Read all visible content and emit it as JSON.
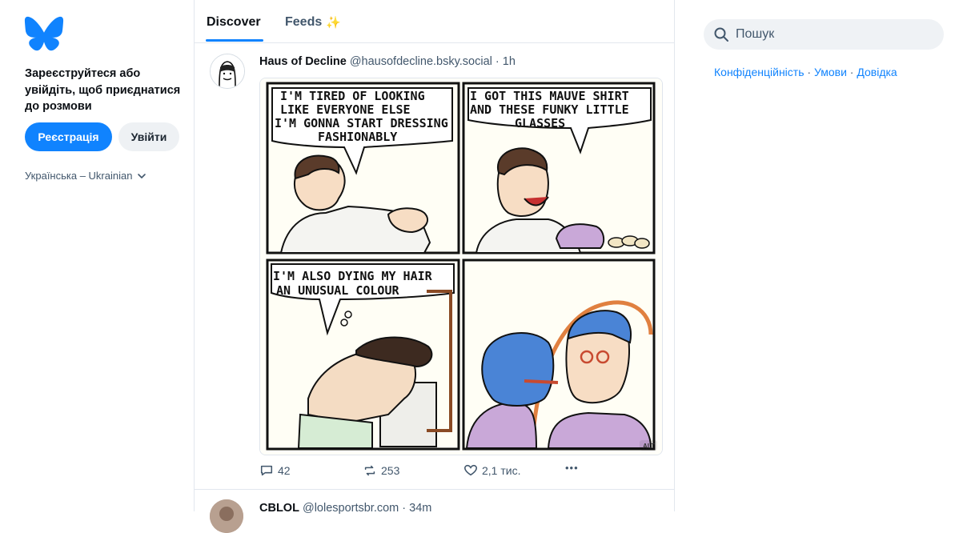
{
  "sidebar": {
    "cta_text": "Зареєструйтеся або увійдіть, щоб приєднатися до розмови",
    "signup_label": "Реєстрація",
    "login_label": "Увійти",
    "language": "Українська – Ukrainian",
    "logo_icon": "butterfly-icon",
    "brand_color": "#1083fe"
  },
  "tabs": [
    {
      "label": "Discover",
      "active": true
    },
    {
      "label": "Feeds",
      "emoji": "✨"
    }
  ],
  "post": {
    "author": "Haus of Decline",
    "handle": "@hausofdecline.bsky.social",
    "time": "1h",
    "comic": {
      "panel1": [
        "I'M TIRED OF LOOKING",
        "LIKE EVERYONE ELSE",
        "I'M GONNA START DRESSING",
        "FASHIONABLY"
      ],
      "panel2": [
        "I GOT THIS MAUVE SHIRT",
        "AND THESE FUNKY LITTLE",
        "GLASSES"
      ],
      "panel3": [
        "I'M ALSO DYING MY HAIR",
        "AN UNUSUAL COLOUR"
      ],
      "alt_badge": "ALT"
    },
    "replies": "42",
    "reposts": "253",
    "likes": "2,1 тис.",
    "more": "•••"
  },
  "post2": {
    "author": "CBLOL",
    "handle": "@lolesportsbr.com",
    "time": "34m"
  },
  "search": {
    "placeholder": "Пошук"
  },
  "footer_links": {
    "privacy": "Конфіденційність",
    "terms": "Умови",
    "help": "Довідка",
    "separator": " · "
  }
}
